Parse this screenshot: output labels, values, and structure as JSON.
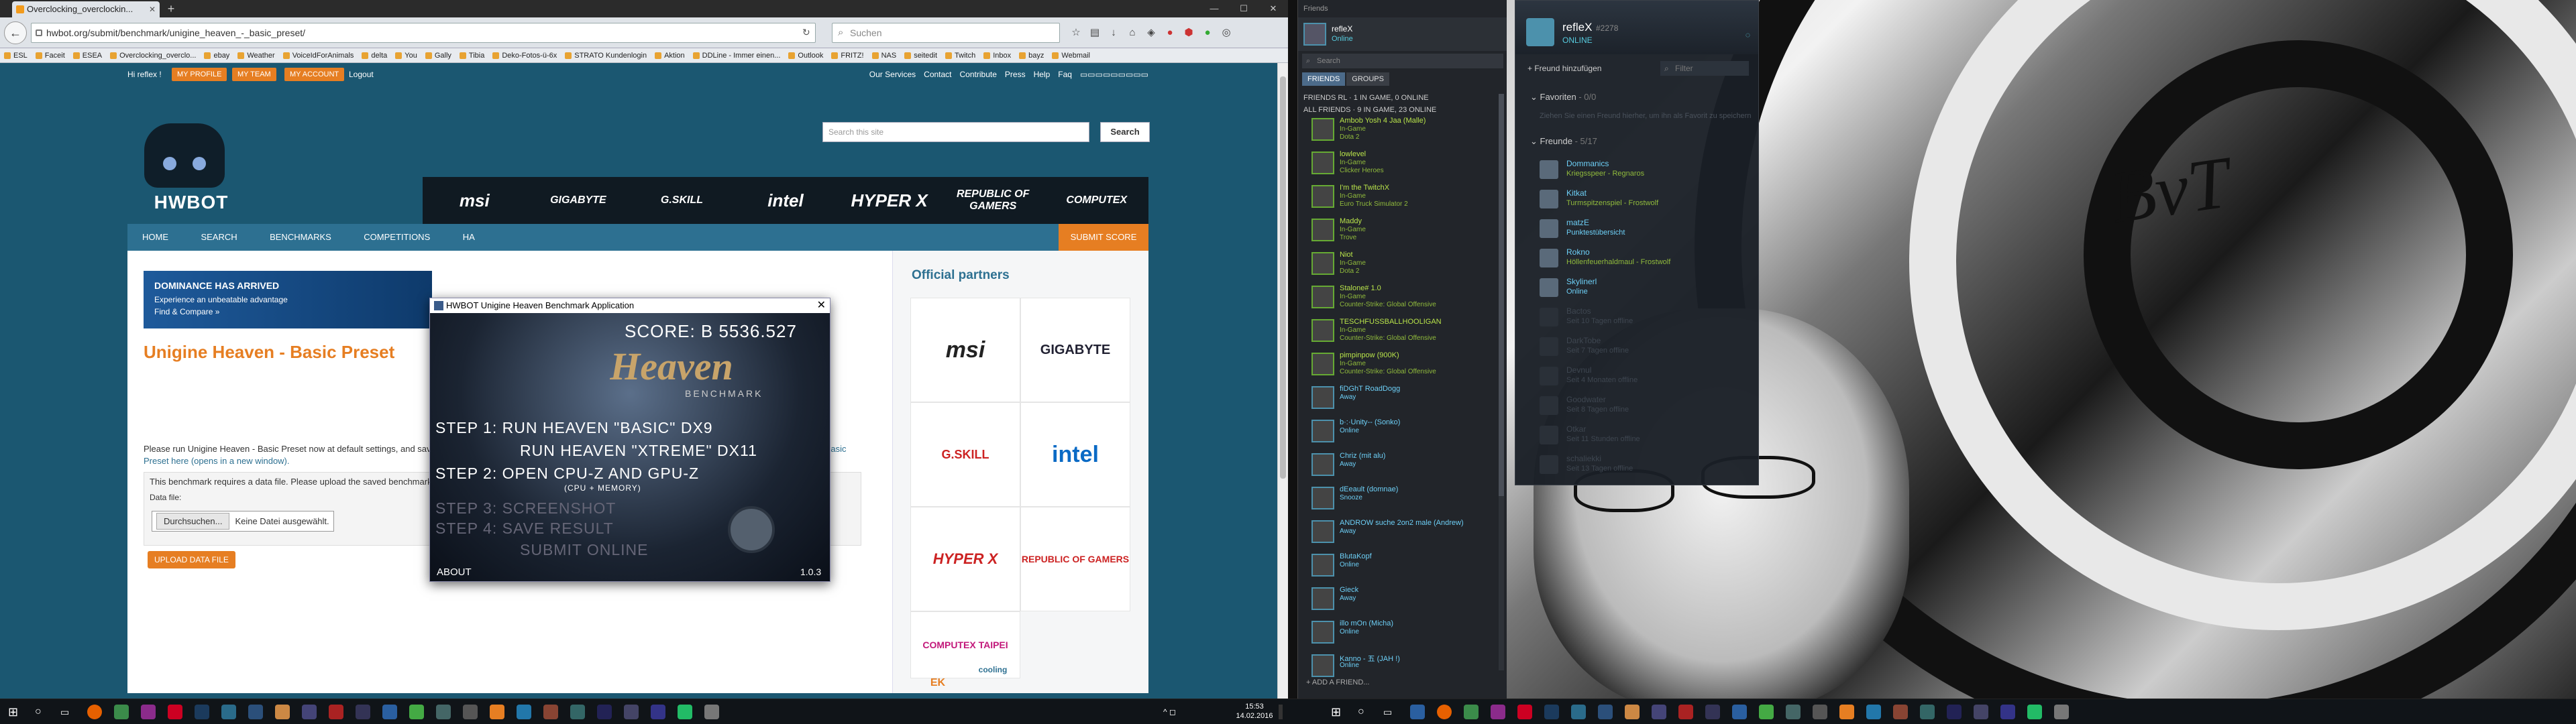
{
  "firefox": {
    "tab_title": "Overclocking_overclockin...",
    "new_tab": "+",
    "url": "hwbot.org/submit/benchmark/unigine_heaven_-_basic_preset/",
    "search_placeholder": "Suchen",
    "bookmarks": [
      "ESL",
      "Faceit",
      "ESEA",
      "Overclocking_overclo...",
      "ebay",
      "Weather",
      "VoiceIdForAnimals",
      "delta",
      "You",
      "Gally",
      "Tibia",
      "Deko-Fotos-ü-6x",
      "STRATO Kundenlogin",
      "Aktion",
      "DDLine - Immer einen...",
      "Outlook",
      "FRITZ!",
      "NAS",
      "seitedit",
      "Twitch",
      "Inbox",
      "bayz",
      "Webmail"
    ]
  },
  "hwbot": {
    "greeting": "Hi reflex !",
    "my_profile": "MY PROFILE",
    "my_team": "MY TEAM",
    "my_account": "MY ACCOUNT",
    "logout": "Logout",
    "top_links": [
      "Our Services",
      "Contact",
      "Contribute",
      "Press",
      "Help",
      "Faq"
    ],
    "brand": "HWBOT",
    "site_search_placeholder": "Search this site",
    "search_button": "Search",
    "sponsors": [
      "msi",
      "GIGABYTE",
      "G.SKILL",
      "intel",
      "HYPER X",
      "REPUBLIC OF GAMERS",
      "COMPUTEX"
    ],
    "menu": [
      "HOME",
      "SEARCH",
      "BENCHMARKS",
      "COMPETITIONS",
      "HA"
    ],
    "submit_score": "SUBMIT SCORE",
    "banner_line1": "DOMINANCE HAS ARRIVED",
    "banner_line2": "Experience an unbeatable advantage",
    "banner_line3": "Find & Compare »",
    "page_title": "Unigine Heaven - Basic Preset",
    "para1": "Please run Unigine Heaven - Basic Preset now at default settings, and save th",
    "para1_link": "aven - Basic",
    "para2": "Preset here (opens in a new window).",
    "para3": "This benchmark requires a data file. Please upload the saved benchmark re",
    "data_file_label": "Data file:",
    "browse_button": "Durchsuchen...",
    "no_file": "Keine Datei ausgewählt.",
    "upload_button": "UPLOAD DATA FILE",
    "partners_title": "Official partners",
    "partners": [
      "msi",
      "GIGABYTE",
      "G.SKILL",
      "intel",
      "HYPER X",
      "REPUBLIC OF GAMERS",
      "COMPUTEX TAIPEI",
      "",
      "EK",
      "cooling"
    ]
  },
  "heaven": {
    "title": "HWBOT Unigine Heaven Benchmark Application",
    "score": "SCORE: B 5536.527",
    "logo": "Heaven",
    "logo_sub": "BENCHMARK",
    "step1a": "STEP 1:  RUN HEAVEN \"BASIC\" DX9",
    "step1b": "RUN HEAVEN \"XTREME\" DX11",
    "step2": "STEP 2: OPEN CPU-Z  AND  GPU-Z",
    "step2_sub": "(CPU + MEMORY)",
    "step3": "STEP 3:        SCREENSHOT",
    "step4": "STEP 4:  SAVE  RESULT",
    "step5": "SUBMIT ONLINE",
    "about": "ABOUT",
    "version": "1.0.3"
  },
  "steam_friends": {
    "title": "Friends",
    "me_name": "refleX",
    "me_status": "Online",
    "search_placeholder": "Search",
    "tabs": [
      "FRIENDS",
      "GROUPS"
    ],
    "group_rl": "FRIENDS RL · 1 IN GAME, 0 ONLINE",
    "group_all": "ALL FRIENDS · 9 IN GAME, 23 ONLINE",
    "friends": [
      {
        "name": "Ambob Yosh 4 Jaa (Malle)",
        "s1": "In-Game",
        "s2": "Dota 2"
      },
      {
        "name": "lowlevel",
        "s1": "In-Game",
        "s2": "Clicker Heroes"
      },
      {
        "name": "I'm the TwitchX",
        "s1": "In-Game",
        "s2": "Euro Truck Simulator 2"
      },
      {
        "name": "Maddy",
        "s1": "In-Game",
        "s2": "Trove"
      },
      {
        "name": "Niot",
        "s1": "In-Game",
        "s2": "Dota 2"
      },
      {
        "name": "Stalone# 1.0",
        "s1": "In-Game",
        "s2": "Counter-Strike: Global Offensive"
      },
      {
        "name": "TESCHFUSSBALLHOOLIGAN",
        "s1": "In-Game",
        "s2": "Counter-Strike: Global Offensive"
      },
      {
        "name": "pimpinpow (900K)",
        "s1": "In-Game",
        "s2": "Counter-Strike: Global Offensive"
      },
      {
        "name": "fiDGhT RoadDogg",
        "s1": "Away",
        "s2": ""
      },
      {
        "name": "b·:·Unity-- (Sonko)",
        "s1": "Online",
        "s2": ""
      },
      {
        "name": "Chriz (mit alu)",
        "s1": "Away",
        "s2": ""
      },
      {
        "name": "dEeault (domnae)",
        "s1": "Snooze",
        "s2": ""
      },
      {
        "name": "ANDROW suche 2on2 male (Andrew)",
        "s1": "Away",
        "s2": ""
      },
      {
        "name": "BlutaKopf",
        "s1": "Online",
        "s2": ""
      },
      {
        "name": "Gieck",
        "s1": "Away",
        "s2": ""
      },
      {
        "name": "illo mOn (Micha)",
        "s1": "Online",
        "s2": ""
      },
      {
        "name": "Kanno - 五 (JAH !)",
        "s1": "Online",
        "s2": ""
      }
    ],
    "add_friend": "+ ADD A FRIEND..."
  },
  "taskbar_left": {
    "time": "15:53",
    "date": "14.02.2016"
  },
  "steam_new": {
    "name": "refleX",
    "tag": "#2278",
    "status": "ONLINE",
    "add_friend": "+ Freund hinzufügen",
    "filter_placeholder": "Filter",
    "fav_header": "Favoriten",
    "fav_count": "- 0/0",
    "fav_empty": "Ziehen Sie einen Freund hierher, um ihn als Favorit zu speichern",
    "friends_header": "Freunde",
    "friends_count": "- 5/17",
    "friends": [
      {
        "name": "Dommanics",
        "status": "Kriegsspeer - Regnaros",
        "on": false
      },
      {
        "name": "Kitkat",
        "status": "Turmspitzenspiel - Frostwolf",
        "on": false
      },
      {
        "name": "matzE",
        "status": "Punktestübersicht",
        "on": true
      },
      {
        "name": "Rokno",
        "status": "Höllenfeuerhaldmaul - Frostwolf",
        "on": false
      },
      {
        "name": "Skylinerl",
        "status": "Online",
        "on": true
      },
      {
        "name": "Bactos",
        "status": "Seit 10 Tagen offline",
        "on": false,
        "off": true
      },
      {
        "name": "DarkTobe",
        "status": "Seit 7 Tagen offline",
        "on": false,
        "off": true
      },
      {
        "name": "Devnul",
        "status": "Seit 4 Monaten offline",
        "on": false,
        "off": true
      },
      {
        "name": "Goodwater",
        "status": "Seit 8 Tagen offline",
        "on": false,
        "off": true
      },
      {
        "name": "Otkar",
        "status": "Seit 11 Stunden offline",
        "on": false,
        "off": true
      },
      {
        "name": "schaliekki",
        "status": "Seit 13 Tagen offline",
        "on": false,
        "off": true
      }
    ]
  }
}
